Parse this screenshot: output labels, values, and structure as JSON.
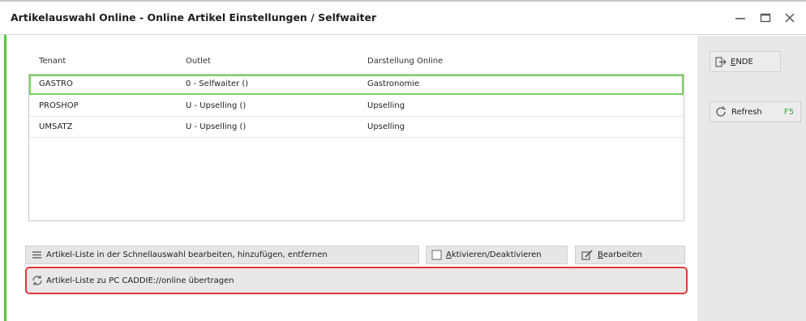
{
  "window": {
    "title": "Artikelauswahl Online - Online Artikel Einstellungen / Selfwaiter"
  },
  "table": {
    "columns": [
      "Tenant",
      "Outlet",
      "Darstellung Online"
    ],
    "rows": [
      {
        "tenant": "GASTRO",
        "outlet": "0 - Selfwaiter ()",
        "display": "Gastronomie",
        "selected": true
      },
      {
        "tenant": "PROSHOP",
        "outlet": "U - Upselling ()",
        "display": "Upselling",
        "selected": false
      },
      {
        "tenant": "UMSATZ",
        "outlet": "U - Upselling ()",
        "display": "Upselling",
        "selected": false
      }
    ]
  },
  "actions": {
    "edit_list_label": "Artikel-Liste in der Schnellauswahl bearbeiten, hinzufügen, entfernen",
    "activate_label": "Aktivieren/Deaktivieren",
    "edit_label": "Bearbeiten",
    "transfer_label": "Artikel-Liste zu PC CADDIE://online übertragen"
  },
  "sidebar": {
    "ende_label": "ENDE",
    "refresh_label": "Refresh",
    "refresh_hotkey": "F5"
  },
  "colors": {
    "selection_border": "#77d45c",
    "highlight_border": "#e0383d",
    "hotkey": "#3aa83a"
  }
}
